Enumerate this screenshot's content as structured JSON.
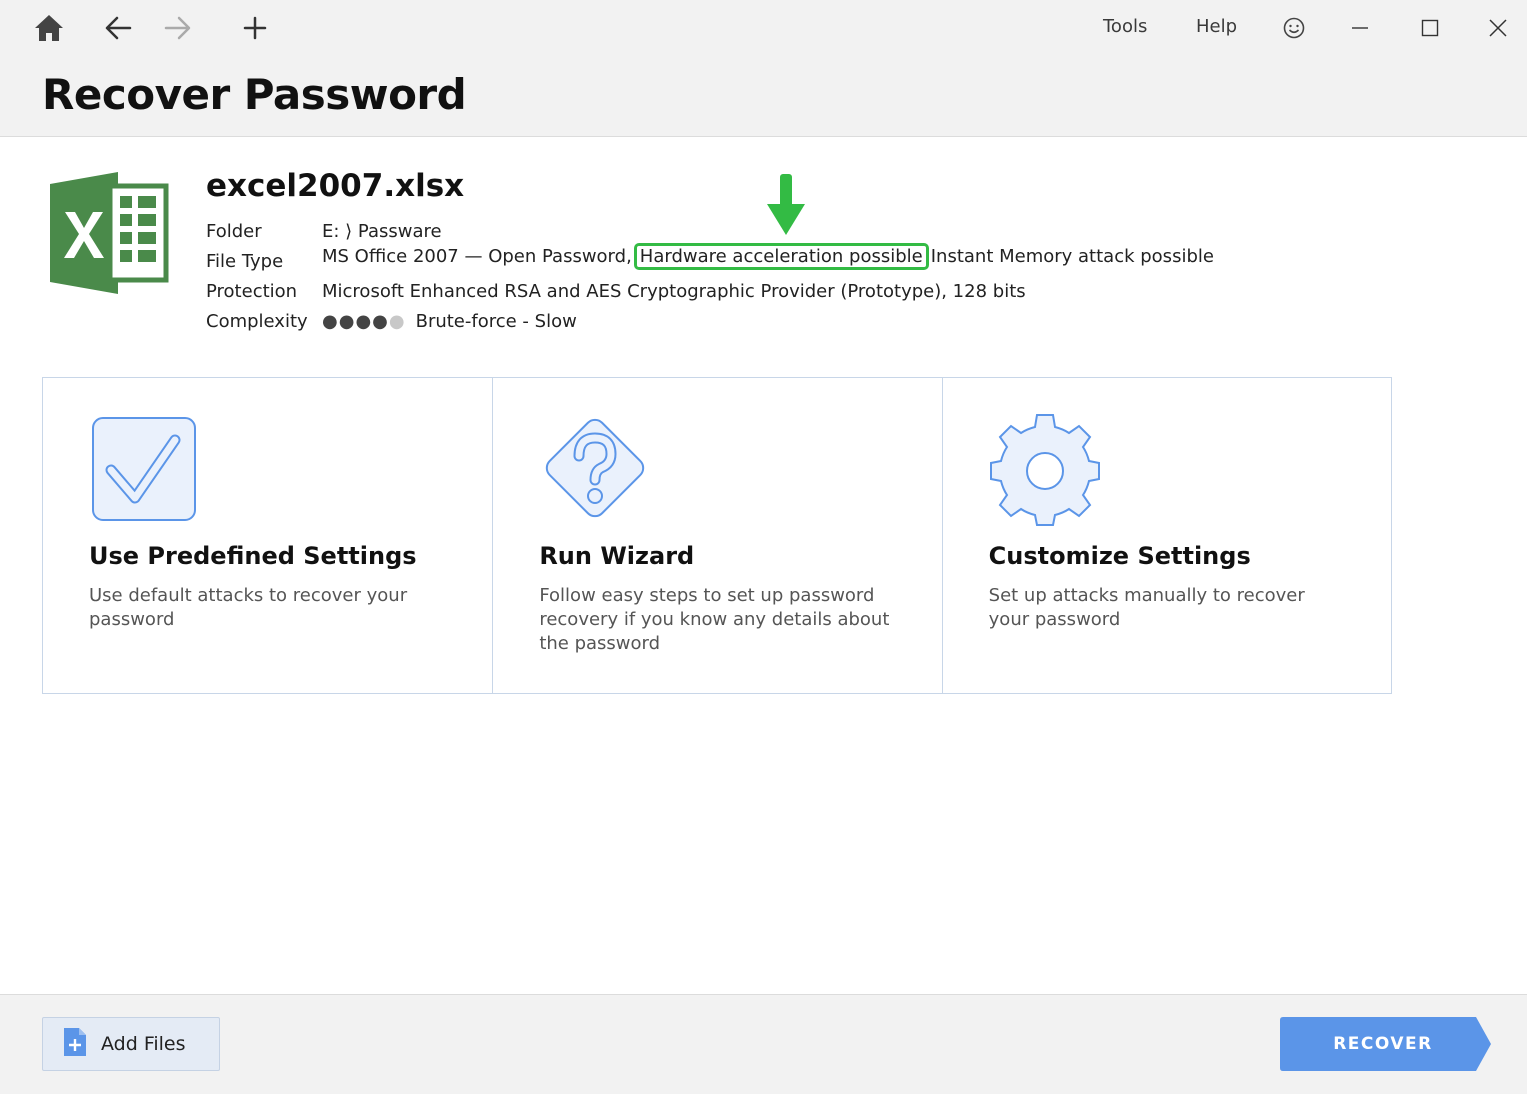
{
  "toolbar": {
    "home_icon": "home-icon",
    "back_icon": "arrow-left-icon",
    "forward_icon": "arrow-right-icon",
    "new_icon": "plus-icon",
    "menu_tools": "Tools",
    "menu_help": "Help",
    "feedback_icon": "smiley-icon",
    "minimize_icon": "minimize-icon",
    "maximize_icon": "maximize-icon",
    "close_icon": "close-icon"
  },
  "page": {
    "title": "Recover Password"
  },
  "file": {
    "name": "excel2007.xlsx",
    "icon": "excel-file-icon",
    "labels": {
      "folder": "Folder",
      "file_type": "File Type",
      "protection": "Protection",
      "complexity": "Complexity"
    },
    "folder": "E: ⟩ Passware",
    "file_type_main": "MS Office 2007 — Open Password,",
    "file_type_highlight": "Hardware acceleration possible",
    "file_type_rest": "Instant Memory attack possible",
    "protection": "Microsoft Enhanced RSA and AES Cryptographic Provider (Prototype), 128 bits",
    "complexity_level": 4,
    "complexity_max": 5,
    "complexity_text": "Brute-force - Slow"
  },
  "annotation": {
    "arrow_color": "#33bb44",
    "box_color": "#33bb44"
  },
  "cards": [
    {
      "icon": "checkmark-icon",
      "title": "Use Predefined Settings",
      "desc": "Use default attacks to recover your password"
    },
    {
      "icon": "question-diamond-icon",
      "title": "Run Wizard",
      "desc": "Follow easy steps to set up password recovery if you know any details about the password"
    },
    {
      "icon": "gear-icon",
      "title": "Customize Settings",
      "desc": "Set up attacks manually to recover your password"
    }
  ],
  "footer": {
    "add_files_label": "Add Files",
    "add_files_icon": "add-file-icon",
    "recover_label": "RECOVER"
  },
  "colors": {
    "accent": "#5b95e8",
    "excel_green": "#4a8a4a",
    "card_icon_stroke": "#5b95e8",
    "card_icon_fill": "#eaf1fc"
  }
}
